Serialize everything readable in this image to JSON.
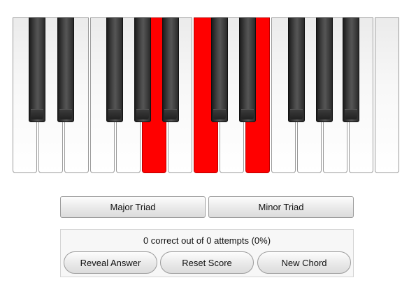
{
  "keyboard": {
    "white_keys": [
      {
        "name": "white-key-1",
        "selected": false
      },
      {
        "name": "white-key-2",
        "selected": false
      },
      {
        "name": "white-key-3",
        "selected": false
      },
      {
        "name": "white-key-4",
        "selected": false
      },
      {
        "name": "white-key-5",
        "selected": false
      },
      {
        "name": "white-key-6",
        "selected": true
      },
      {
        "name": "white-key-7",
        "selected": false
      },
      {
        "name": "white-key-8",
        "selected": true
      },
      {
        "name": "white-key-9",
        "selected": false
      },
      {
        "name": "white-key-10",
        "selected": true
      },
      {
        "name": "white-key-11",
        "selected": false
      },
      {
        "name": "white-key-12",
        "selected": false
      },
      {
        "name": "white-key-13",
        "selected": false
      },
      {
        "name": "white-key-14",
        "selected": false
      },
      {
        "name": "white-key-15",
        "selected": false
      }
    ],
    "black_keys": [
      {
        "name": "black-key-1"
      },
      {
        "name": "black-key-2"
      },
      {
        "name": "black-key-3"
      },
      {
        "name": "black-key-4"
      },
      {
        "name": "black-key-5"
      },
      {
        "name": "black-key-6"
      },
      {
        "name": "black-key-7"
      },
      {
        "name": "black-key-8"
      },
      {
        "name": "black-key-9"
      },
      {
        "name": "black-key-10"
      }
    ],
    "selected_color": "#ff0000"
  },
  "chord_buttons": {
    "major_label": "Major Triad",
    "minor_label": "Minor Triad"
  },
  "score": {
    "text": "0 correct out of 0 attempts (0%)",
    "reveal_label": "Reveal Answer",
    "reset_label": "Reset Score",
    "new_chord_label": "New Chord"
  }
}
